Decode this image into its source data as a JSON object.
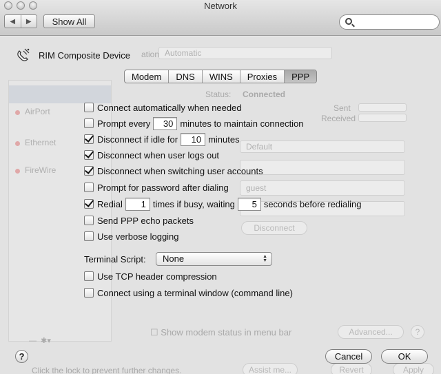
{
  "window": {
    "title": "Network"
  },
  "toolbar": {
    "show_all_label": "Show All",
    "back_arrow": "◀",
    "forward_arrow": "▶",
    "search_placeholder": ""
  },
  "device": {
    "name": "RIM Composite Device",
    "icon": "phone-modem-icon"
  },
  "tabs": [
    {
      "label": "Modem",
      "active": false
    },
    {
      "label": "DNS",
      "active": false
    },
    {
      "label": "WINS",
      "active": false
    },
    {
      "label": "Proxies",
      "active": false
    },
    {
      "label": "PPP",
      "active": true
    }
  ],
  "options": {
    "connect_auto": {
      "label": "Connect automatically when needed",
      "checked": false
    },
    "prompt_every": {
      "label_before": "Prompt every",
      "value": "30",
      "label_after": "minutes to maintain connection",
      "checked": false
    },
    "disconnect_idle": {
      "label_before": "Disconnect if idle for",
      "value": "10",
      "label_after": "minutes",
      "checked": true
    },
    "disconnect_logout": {
      "label": "Disconnect when user logs out",
      "checked": true
    },
    "disconnect_switch": {
      "label": "Disconnect when switching user accounts",
      "checked": true
    },
    "prompt_password": {
      "label": "Prompt for password after dialing",
      "checked": false
    },
    "redial": {
      "label_before": "Redial",
      "times_value": "1",
      "label_mid": "times if busy, waiting",
      "seconds_value": "5",
      "label_after": "seconds before redialing",
      "checked": true
    },
    "echo_packets": {
      "label": "Send PPP echo packets",
      "checked": false
    },
    "verbose_logging": {
      "label": "Use verbose logging",
      "checked": false
    },
    "tcp_compression": {
      "label": "Use TCP header compression",
      "checked": false
    },
    "terminal_window": {
      "label": "Connect using a terminal window (command line)",
      "checked": false
    }
  },
  "terminal_script": {
    "label": "Terminal Script:",
    "value": "None"
  },
  "footer": {
    "help_label": "?",
    "cancel_label": "Cancel",
    "ok_label": "OK"
  },
  "background": {
    "config_label": "ation:",
    "config_value": "Automatic",
    "status_label": "Status:",
    "status_value": "Connected",
    "sent_label": "Sent",
    "received_label": "Received",
    "services": [
      "AirPort",
      "Ethernet",
      "FireWire"
    ],
    "default_value": "Default",
    "account_value": "guest",
    "disconnect_label": "Disconnect",
    "modem_status_label": "Show modem status in menu bar",
    "advanced_label": "Advanced...",
    "lock_text": "Click the lock to prevent further changes.",
    "assist_label": "Assist me...",
    "revert_label": "Revert",
    "apply_label": "Apply"
  }
}
